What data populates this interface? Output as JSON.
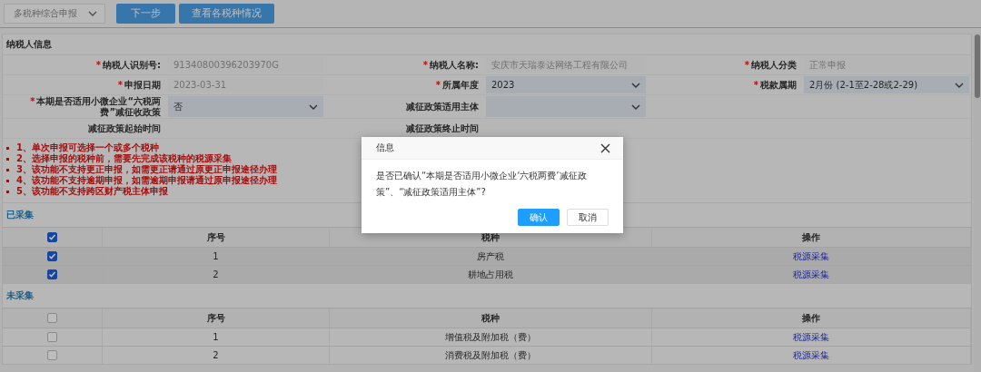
{
  "toolbar": {
    "declaration_type": "多税种综合申报",
    "buttons": [
      "下一步",
      "查看各税种情况"
    ]
  },
  "taxpayer_info": {
    "title": "纳税人信息",
    "fields": [
      {
        "label": "纳税人识别号:",
        "required_mark": "*",
        "kind": "text",
        "value": "91340800396203970G"
      },
      {
        "label": "纳税人名称:",
        "required_mark": "*",
        "kind": "text",
        "value": "安庆市天瑞泰达网络工程有限公司"
      },
      {
        "label": "纳税人分类",
        "required_mark": "*",
        "kind": "text",
        "value": "正常申报"
      },
      {
        "label": "申报日期",
        "required_mark": "*",
        "kind": "text",
        "value": "2023-03-31"
      },
      {
        "label": "所属年度",
        "required_mark": "*",
        "kind": "select",
        "value": "2023"
      },
      {
        "label": "税款属期",
        "required_mark": "*",
        "kind": "select",
        "value": "2月份 (2-1至2-28或2-29)"
      },
      {
        "label": "本期是否适用小微企业“六税两费”减征收政策",
        "required_mark": "*",
        "kind": "select",
        "value": "否"
      },
      {
        "label": "减征政策适用主体",
        "kind": "select"
      },
      {
        "kind": "blank"
      },
      {
        "label": "减征政策起始时间",
        "kind": "text"
      },
      {
        "label": "减征政策终止时间",
        "kind": "text"
      },
      {
        "kind": "blank"
      }
    ]
  },
  "notes": [
    "1、单次申报可选择一个或多个税种",
    "2、选择申报的税种前，需要先完成该税种的税源采集",
    "3、该功能不支持更正申报，如需更正请通过原更正申报途径办理",
    "4、该功能不支持逾期申报，如需逾期申报请通过原申报途径办理",
    "5、该功能不支持跨区财产税主体申报"
  ],
  "sections": [
    {
      "title": "已采集",
      "all_checked": true,
      "columns": [
        "序号",
        "税种",
        "操作"
      ],
      "rows": [
        {
          "checked": true,
          "number": "1",
          "tax": "房产税",
          "action": "税源采集"
        },
        {
          "checked": true,
          "number": "2",
          "tax": "耕地占用税",
          "action": "税源采集"
        }
      ]
    },
    {
      "title": "未采集",
      "all_checked": false,
      "columns": [
        "序号",
        "税种",
        "操作"
      ],
      "rows": [
        {
          "checked": false,
          "number": "1",
          "tax": "增值税及附加税（费）",
          "action": "税源采集"
        },
        {
          "checked": false,
          "number": "2",
          "tax": "消费税及附加税（费）",
          "action": "税源采集"
        }
      ]
    }
  ],
  "dialog": {
    "title": "信息",
    "message": "是否已确认“本期是否适用小微企业‘六税两费’减征政策”、“减征政策适用主体”?",
    "buttons": [
      "确认",
      "取消"
    ]
  }
}
